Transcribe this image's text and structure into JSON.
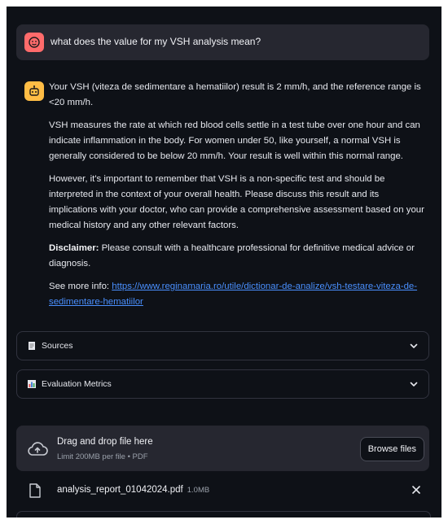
{
  "user_message": {
    "text": "what does the value for my VSH analysis mean?"
  },
  "assistant_message": {
    "p1": "Your VSH (viteza de sedimentare a hematiilor) result is 2 mm/h, and the reference range is <20 mm/h.",
    "p2": "VSH measures the rate at which red blood cells settle in a test tube over one hour and can indicate inflammation in the body. For women under 50, like yourself, a normal VSH is generally considered to be below 20 mm/h. Your result is well within this normal range.",
    "p3": "However, it's important to remember that VSH is a non-specific test and should be interpreted in the context of your overall health. Please discuss this result and its implications with your doctor, who can provide a comprehensive assessment based on your medical history and any other relevant factors.",
    "disclaimer_label": "Disclaimer:",
    "disclaimer_text": " Please consult with a healthcare professional for definitive medical advice or diagnosis.",
    "more_info_label": "See more info: ",
    "more_info_link": "https://www.reginamaria.ro/utile/dictionar-de-analize/vsh-testare-viteza-de-sedimentare-hematiilor"
  },
  "expanders": [
    {
      "label": "Sources",
      "icon": "page-icon"
    },
    {
      "label": "Evaluation Metrics",
      "icon": "bar-chart-icon"
    }
  ],
  "uploader": {
    "title": "Drag and drop file here",
    "subtitle": "Limit 200MB per file • PDF",
    "button_label": "Browse files"
  },
  "uploaded_file": {
    "name": "analysis_report_01042024.pdf",
    "size": "1.0MB"
  },
  "colors": {
    "background": "#0e1117",
    "user_avatar": "#ff6b6b",
    "bot_avatar": "#ffbd45",
    "link": "#4a90ff"
  }
}
